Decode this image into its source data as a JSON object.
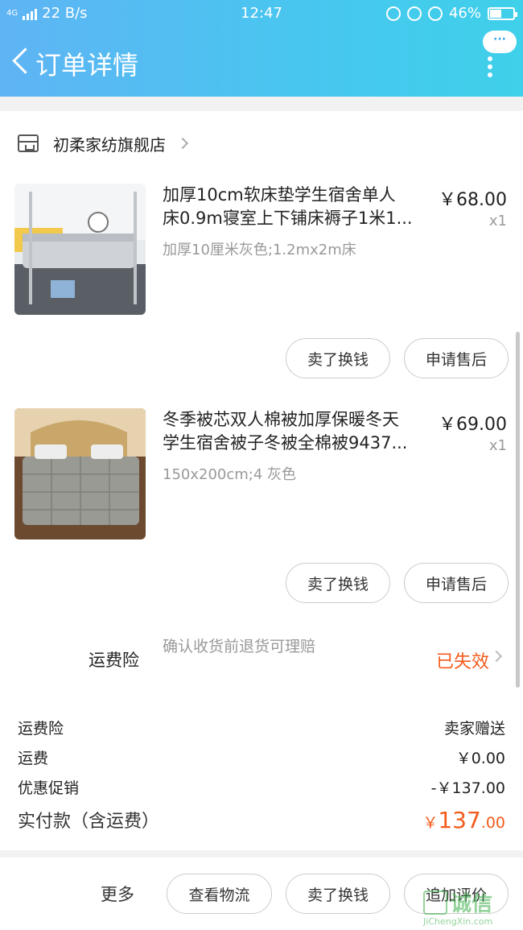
{
  "status_bar": {
    "network_label": "4G",
    "speed": "22 B/s",
    "time": "12:47",
    "battery": "46%",
    "battery_level": 0.46
  },
  "nav": {
    "title": "订单详情",
    "more_label": "···"
  },
  "shop": {
    "name": "初柔家纺旗舰店"
  },
  "items": [
    {
      "name_line1": "加厚10cm软床垫学生宿舍单人",
      "name_line2": "床0.9m寝室上下铺床褥子1米1...",
      "variant": "加厚10厘米灰色;1.2mx2m床",
      "price": "￥68.00",
      "qty": "x1",
      "btn_sell": "卖了换钱",
      "btn_aftersale": "申请售后"
    },
    {
      "name_line1": "冬季被芯双人棉被加厚保暖冬天",
      "name_line2": "学生宿舍被子冬被全棉被9437...",
      "variant": "150x200cm;4   灰色",
      "price": "￥69.00",
      "qty": "x1",
      "btn_sell": "卖了换钱",
      "btn_aftersale": "申请售后"
    }
  ],
  "insurance": {
    "label": "运费险",
    "desc": "确认收货前退货可理赔",
    "status": "已失效"
  },
  "summary": {
    "insurance_label": "运费险",
    "insurance_value": "卖家赠送",
    "shipping_label": "运费",
    "shipping_value": "￥0.00",
    "discount_label": "优惠促销",
    "discount_value": "-￥137.00",
    "total_label": "实付款（含运费）",
    "total_currency": "￥",
    "total_int": "137",
    "total_dec": ".00"
  },
  "bottom": {
    "more": "更多",
    "logistics": "查看物流",
    "sell": "卖了换钱",
    "review": "追加评价"
  },
  "watermark": {
    "text": "诚信",
    "url": "JiChengXin.com"
  },
  "colors": {
    "accent": "#f35b1c",
    "header_start": "#5fb4f4",
    "header_end": "#3fd0ea"
  }
}
